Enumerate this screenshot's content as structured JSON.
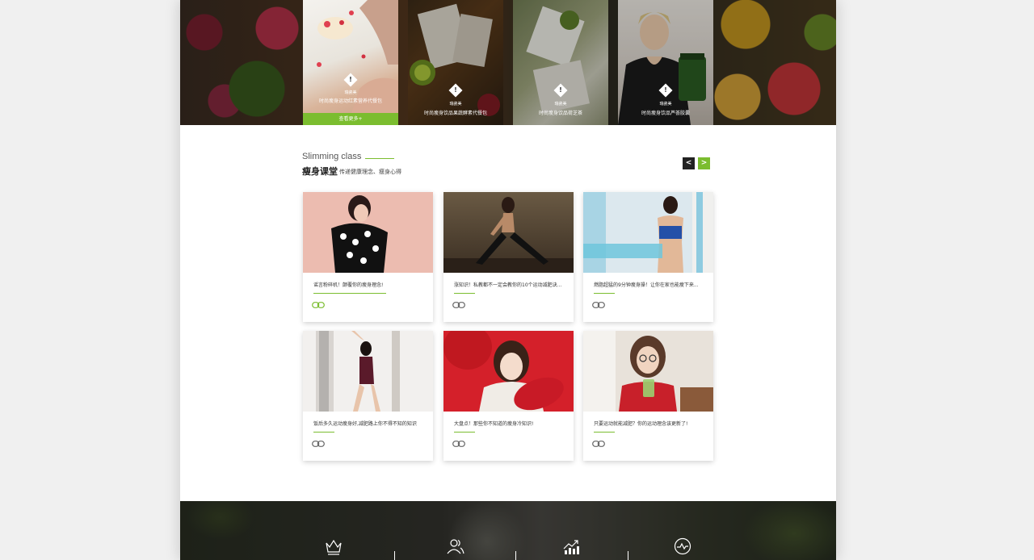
{
  "hero": {
    "cards": [
      {
        "tag": "瑞瓷美",
        "caption": "时尚瘦身运动红素营养代餐包",
        "more_label": "查看更多+"
      },
      {
        "tag": "瑞瓷美",
        "caption": "时尚瘦身饮品果蔬酵素代餐包"
      },
      {
        "tag": "瑞瓷美",
        "caption": "时尚瘦身饮品荷芝茶"
      },
      {
        "tag": "瑞瓷美",
        "caption": "时尚瘦身饮品芦荟胶囊"
      }
    ]
  },
  "section": {
    "title_en": "Slimming class",
    "title_cn": "瘦身课堂",
    "subtitle": "传递健康理念、瘦身心得",
    "prev_label": "<",
    "next_label": ">"
  },
  "articles": [
    {
      "title": "谣言粉碎机！颠覆你的瘦身理念!"
    },
    {
      "title": "涨知识！私教都不一定会教你的10个运动减肥诀..."
    },
    {
      "title": "燃脂超猛的9分钟瘦身操！让你在家也能瘦下来..."
    },
    {
      "title": "饭后多久运动瘦身好,减肥路上你不得不知的知识"
    },
    {
      "title": "大盘点！那些你不知道的瘦身冷知识!"
    },
    {
      "title": "只要运动就能减肥？你的运动理念该更新了!"
    }
  ],
  "colors": {
    "accent": "#7bbd2f",
    "dark": "#222222"
  }
}
